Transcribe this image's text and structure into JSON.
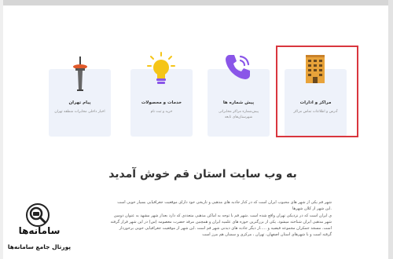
{
  "cards": [
    {
      "title": "پیام تهران",
      "desc": "اخبار داخلی مخابرات منطقه تهران",
      "icon": "tower-icon"
    },
    {
      "title": "خدمات و محصولات",
      "desc": "خرید و ثبت نام",
      "icon": "lightbulb-icon"
    },
    {
      "title": "پیش شماره ها",
      "desc": "پیش‌شماره مراکز مخابراتی شهرستان‌های تابعه",
      "icon": "phone-icon"
    },
    {
      "title": "مراکز و ادارات",
      "desc": "آدرس و اطلاعات تماس مراکز",
      "icon": "building-icon"
    }
  ],
  "heading": "به وب سایت استان قم خوش آمدید",
  "paragraph": [
    "شهر قم یکی از شهر های محبوب ایران است که در کنار جاذبه های مذهبی و تاریخی خود دارای موقعیت جغرافیایی بسیار خوبی است",
    ".این شهر از کلان شهرها",
    "ی ایران است که در نزدیکی تهران واقع شده است .شهر قم با توجه به اماکن مذهبی متعددی که دارد بعداز شهر مشهد به عنوان دومین",
    "شهر مذهبی ایران شناخته میشود. یکی از بزرگترین حوزه های علمیه ایران و همچنین مرقد حضرت معصومه (س) در این شهر قرار گرفته",
    "است. مسجد جمکران مجموعه فیضیه و .....از دیگر جاذبه های دیدنی شهر قم است .این شهر از موقعیت جغرافیایی خوبی برخوردار",
    "گرفته است و با شهرهای استان اصفهان، تهران ، مرکزی و سمنان هم مرز است"
  ],
  "logo": {
    "name": "سامانه‌ها",
    "subtitle": "پورتال جامع سامانه‌ها",
    "icon": "magnifier-icon"
  },
  "colors": {
    "highlight": "#d9363e",
    "card_bg": "#eef2fa",
    "phone": "#8a56e8",
    "bulb": "#f5c518"
  }
}
